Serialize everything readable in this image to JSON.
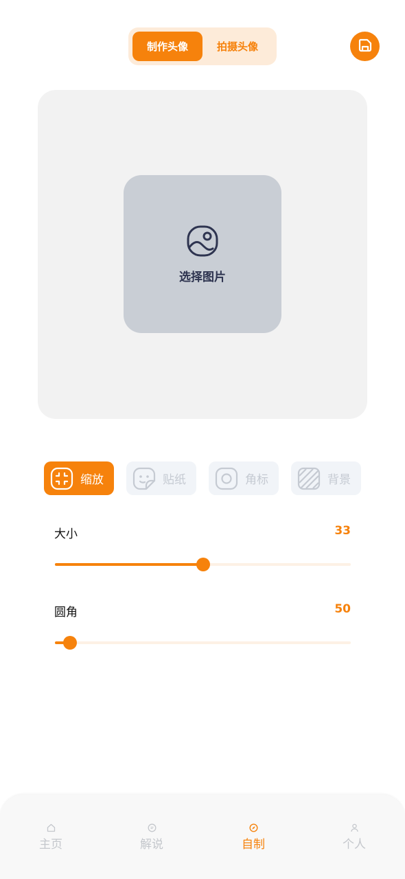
{
  "header": {
    "tabs": [
      {
        "label": "制作头像",
        "active": true
      },
      {
        "label": "拍摄头像",
        "active": false
      }
    ],
    "save_icon": "save-icon"
  },
  "canvas": {
    "picker_label": "选择图片",
    "picker_icon": "image-icon"
  },
  "tools": [
    {
      "label": "缩放",
      "icon": "scale-icon",
      "active": true
    },
    {
      "label": "贴纸",
      "icon": "sticker-icon",
      "active": false
    },
    {
      "label": "角标",
      "icon": "badge-icon",
      "active": false
    },
    {
      "label": "背景",
      "icon": "background-icon",
      "active": false
    }
  ],
  "sliders": [
    {
      "label": "大小",
      "value": "33",
      "fraction": 0.5
    },
    {
      "label": "圆角",
      "value": "50",
      "fraction": 0.05
    }
  ],
  "tabbar": {
    "items": [
      {
        "label": "主页",
        "icon": "home-icon",
        "active": false
      },
      {
        "label": "解说",
        "icon": "comment-icon",
        "active": false
      },
      {
        "label": "自制",
        "icon": "compass-icon",
        "active": true
      },
      {
        "label": "个人",
        "icon": "user-icon",
        "active": false
      }
    ]
  },
  "colors": {
    "accent": "#f6820c",
    "accent_light": "#fdebd9",
    "inactive": "#c4c7cc",
    "canvas_bg": "#f2f2f2",
    "picker_bg": "#c9ced5"
  }
}
